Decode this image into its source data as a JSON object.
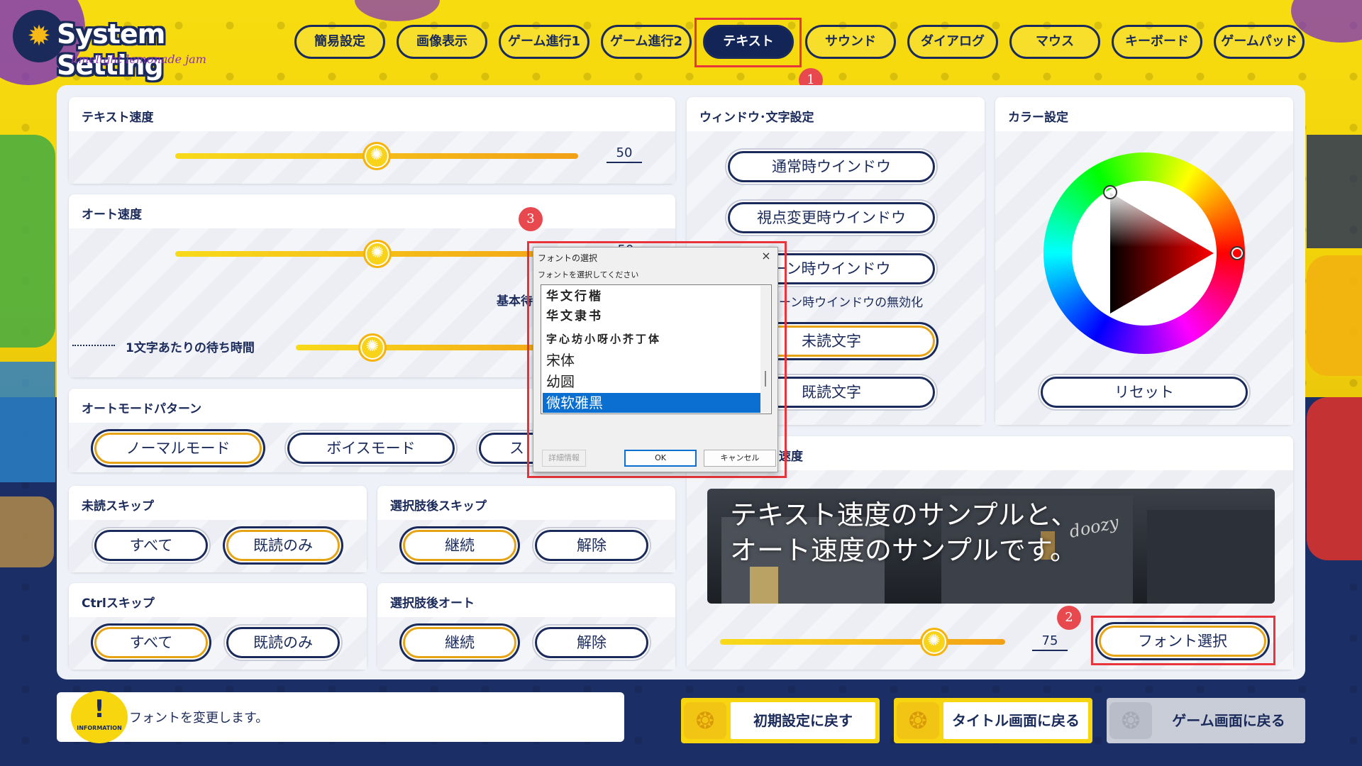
{
  "header": {
    "logo_title": "System Setting",
    "logo_subtitle": "limelight lemonade jam"
  },
  "tabs": [
    {
      "label": "簡易設定",
      "active": false
    },
    {
      "label": "画像表示",
      "active": false
    },
    {
      "label": "ゲーム進行1",
      "active": false
    },
    {
      "label": "ゲーム進行2",
      "active": false
    },
    {
      "label": "テキスト",
      "active": true
    },
    {
      "label": "サウンド",
      "active": false
    },
    {
      "label": "ダイアログ",
      "active": false
    },
    {
      "label": "マウス",
      "active": false
    },
    {
      "label": "キーボード",
      "active": false
    },
    {
      "label": "ゲームパッド",
      "active": false
    }
  ],
  "annotations": {
    "badge1": "1",
    "badge2": "2",
    "badge3": "3"
  },
  "text_speed": {
    "title": "テキスト速度",
    "value": "50",
    "level": 0.5
  },
  "auto_speed": {
    "title": "オート速度",
    "value": "50",
    "base_label": "基本待",
    "per_char_label": "1文字あたりの待ち時間"
  },
  "auto_mode": {
    "title": "オートモードパターン",
    "buttons": [
      "ノーマルモード",
      "ボイスモード",
      "ス"
    ]
  },
  "unread_skip": {
    "title": "未読スキップ",
    "buttons": [
      "すべて",
      "既読のみ"
    ]
  },
  "after_choice_skip": {
    "title": "選択肢後スキップ",
    "buttons": [
      "継続",
      "解除"
    ]
  },
  "ctrl_skip": {
    "title": "Ctrlスキップ",
    "buttons": [
      "すべて",
      "既読のみ"
    ]
  },
  "after_choice_auto": {
    "title": "選択肢後オート",
    "buttons": [
      "継続",
      "解除"
    ]
  },
  "window_text": {
    "title": "ウィンドウ･文字設定",
    "buttons": [
      "通常時ウインドウ",
      "視点変更時ウインドウ",
      "ーン時ウインドウ",
      "未読文字",
      "既読文字"
    ],
    "disable_label": "ーン時ウインドウの無効化"
  },
  "color": {
    "title": "カラー設定",
    "reset": "リセット"
  },
  "preview": {
    "title_fragment": "速度",
    "line1": "テキスト速度のサンプルと、",
    "line2": "オート速度のサンプルです。",
    "sign": "doozy",
    "value": "75",
    "level": 0.75,
    "font_button": "フォント選択"
  },
  "footer": {
    "info_label": "INFORMATION",
    "info_mark": "!",
    "info_text": "フォントを変更します。",
    "buttons": [
      "初期設定に戻す",
      "タイトル画面に戻る",
      "ゲーム画面に戻る"
    ]
  },
  "dialog": {
    "title": "フォントの選択",
    "close": "×",
    "prompt": "フォントを選択してください",
    "fonts": [
      "华文行楷",
      "华文隶书",
      "字心坊小呀小芥丁体",
      "宋体",
      "幼圆",
      "微软雅黑"
    ],
    "selected_index": 5,
    "details": "詳細情報",
    "ok": "OK",
    "cancel": "キャンセル"
  },
  "colors": {
    "accent_red": "#e8353b",
    "navy": "#1a2a5a",
    "yellow": "#f7d50f",
    "selection_blue": "#0a6fd1"
  }
}
